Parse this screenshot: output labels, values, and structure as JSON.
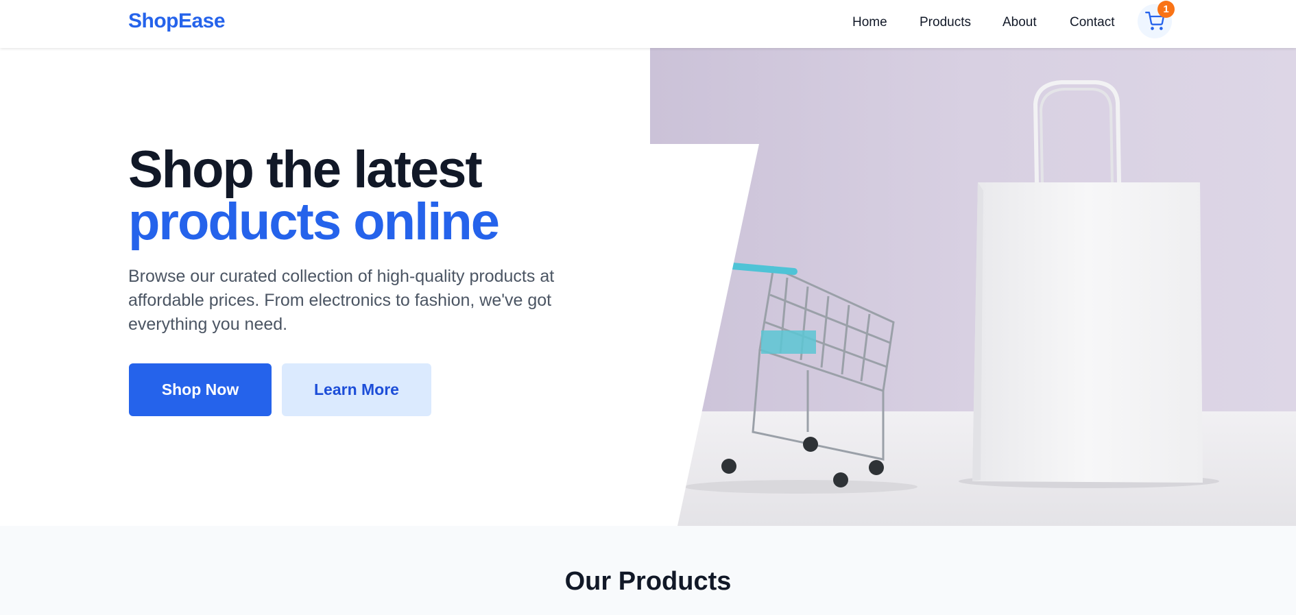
{
  "brand": {
    "name": "ShopEase",
    "color": "#2563eb"
  },
  "nav": {
    "items": [
      {
        "label": "Home"
      },
      {
        "label": "Products"
      },
      {
        "label": "About"
      },
      {
        "label": "Contact"
      }
    ],
    "cart": {
      "icon": "shopping-cart-icon",
      "count": "1",
      "badge_color": "#f97316"
    }
  },
  "hero": {
    "title_line1": "Shop the latest",
    "title_line2": "products online",
    "description": "Browse our curated collection of high-quality products at affordable prices. From electronics to fashion, we've got everything you need.",
    "primary_button": "Shop Now",
    "secondary_button": "Learn More",
    "image": "shopping-cart-and-paper-bag-photo"
  },
  "products_section": {
    "title": "Our Products"
  }
}
